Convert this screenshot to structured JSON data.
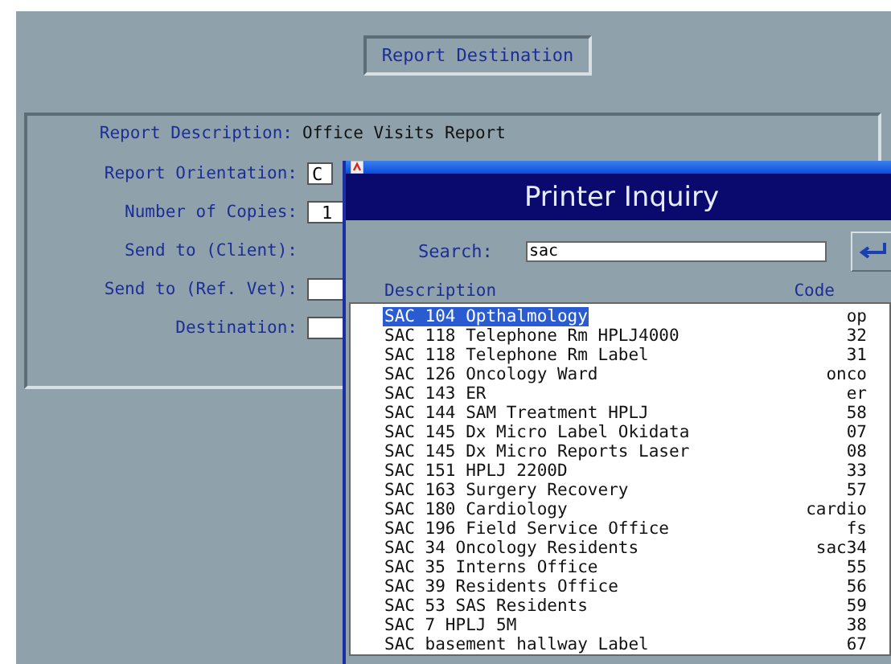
{
  "header": {
    "title": "Report Destination"
  },
  "form": {
    "fields": [
      {
        "label": "Report Description:",
        "kind": "text",
        "value": "Office Visits Report"
      },
      {
        "label": "Report Orientation:",
        "kind": "short",
        "value": "C"
      },
      {
        "label": "Number of Copies:",
        "kind": "input",
        "value": "1"
      },
      {
        "label": "Send to (Client):",
        "kind": "none"
      },
      {
        "label": "Send to (Ref. Vet):",
        "kind": "input"
      },
      {
        "label": "Destination:",
        "kind": "input"
      }
    ]
  },
  "dialog": {
    "title": "Printer Inquiry",
    "search": {
      "label": "Search:",
      "value": "sac"
    },
    "columns": [
      "Description",
      "Code"
    ],
    "rows": [
      {
        "description": "SAC 104 Opthalmology",
        "code": "op",
        "selected": true
      },
      {
        "description": "SAC 118 Telephone Rm HPLJ4000",
        "code": "32",
        "selected": false
      },
      {
        "description": "SAC 118 Telephone Rm Label",
        "code": "31",
        "selected": false
      },
      {
        "description": "SAC 126 Oncology Ward",
        "code": "onco",
        "selected": false
      },
      {
        "description": "SAC 143 ER",
        "code": "er",
        "selected": false
      },
      {
        "description": "SAC 144 SAM Treatment HPLJ",
        "code": "58",
        "selected": false
      },
      {
        "description": "SAC 145 Dx Micro Label Okidata",
        "code": "07",
        "selected": false
      },
      {
        "description": "SAC 145 Dx Micro Reports Laser",
        "code": "08",
        "selected": false
      },
      {
        "description": "SAC 151 HPLJ 2200D",
        "code": "33",
        "selected": false
      },
      {
        "description": "SAC 163 Surgery Recovery",
        "code": "57",
        "selected": false
      },
      {
        "description": "SAC 180 Cardiology",
        "code": "cardio",
        "selected": false
      },
      {
        "description": "SAC 196 Field Service Office",
        "code": "fs",
        "selected": false
      },
      {
        "description": "SAC 34 Oncology Residents",
        "code": "sac34",
        "selected": false
      },
      {
        "description": "SAC 35 Interns Office",
        "code": "55",
        "selected": false
      },
      {
        "description": "SAC 39 Residents Office",
        "code": "56",
        "selected": false
      },
      {
        "description": "SAC 53 SAS Residents",
        "code": "59",
        "selected": false
      },
      {
        "description": "SAC 7 HPLJ 5M",
        "code": "38",
        "selected": false
      },
      {
        "description": "SAC basement hallway Label",
        "code": "67",
        "selected": false
      }
    ]
  }
}
